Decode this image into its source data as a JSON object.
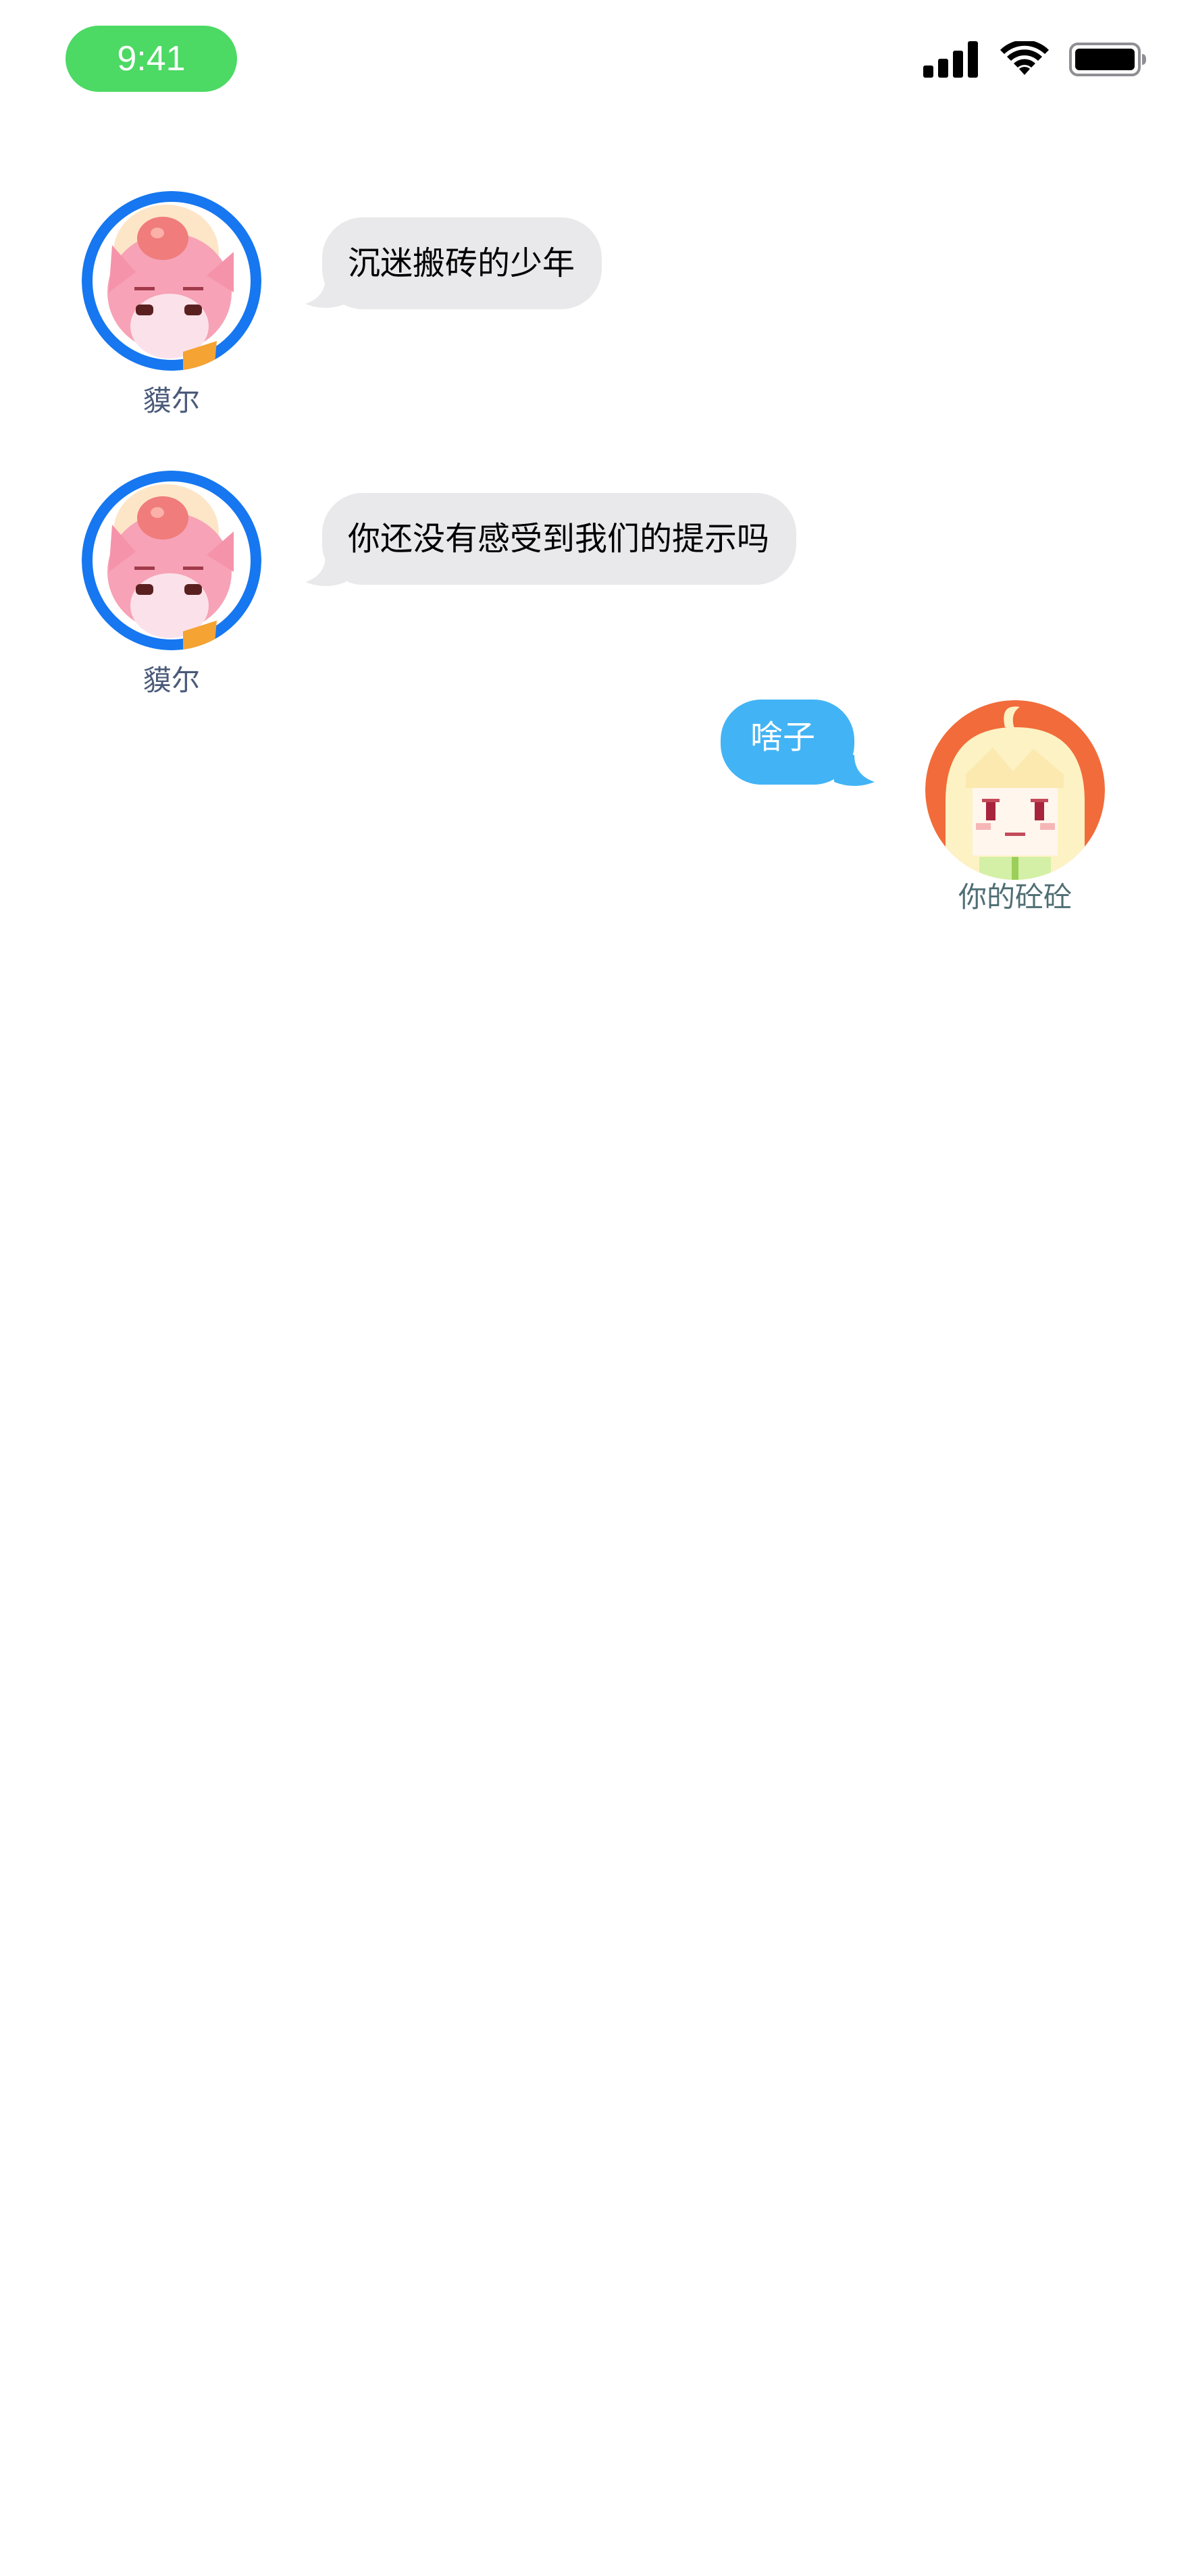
{
  "status_bar": {
    "time": "9:41",
    "signal_icon": "cellular-signal-icon",
    "wifi_icon": "wifi-icon",
    "battery_icon": "battery-full-icon",
    "time_pill_color": "#4cd964"
  },
  "messages": [
    {
      "sender": "貘尔",
      "text": "沉迷搬砖的少年",
      "side": "left",
      "avatar": "pink-creature-avatar",
      "avatar_ring_color": "#1677f0"
    },
    {
      "sender": "貘尔",
      "text": "你还没有感受到我们的提示吗",
      "side": "left",
      "avatar": "pink-creature-avatar",
      "avatar_ring_color": "#1677f0"
    },
    {
      "sender": "你的砼砼",
      "text": "啥子",
      "side": "right",
      "avatar": "blonde-pixel-girl-avatar",
      "avatar_bg_color": "#f26b3a"
    }
  ],
  "colors": {
    "incoming_bubble": "#e9e9eb",
    "outgoing_bubble": "#42b4f5",
    "background": "#ffffff"
  }
}
